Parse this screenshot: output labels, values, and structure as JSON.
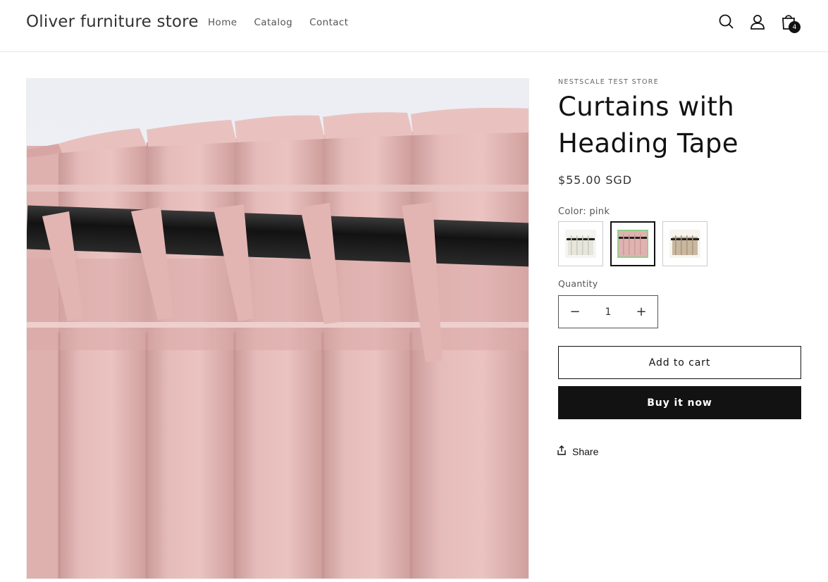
{
  "store": {
    "name": "Oliver furniture store"
  },
  "nav": {
    "items": [
      "Home",
      "Catalog",
      "Contact"
    ]
  },
  "header_icons": {
    "search": "search-icon",
    "account": "account-icon",
    "cart": "cart-icon"
  },
  "cart": {
    "count": "4"
  },
  "product": {
    "vendor": "NESTSCALE TEST STORE",
    "title": "Curtains with Heading Tape",
    "price": "$55.00 SGD",
    "color_label": "Color: pink",
    "colors": [
      {
        "name": "white",
        "hex": "#efefe8"
      },
      {
        "name": "pink",
        "hex": "#e2b5b3"
      },
      {
        "name": "beige",
        "hex": "#c9b79f"
      }
    ],
    "selected_color": "pink",
    "quantity_label": "Quantity",
    "quantity": "1",
    "decrease_symbol": "−",
    "increase_symbol": "+",
    "add_to_cart": "Add to cart",
    "buy_now": "Buy it now",
    "share": "Share"
  },
  "colors": {
    "accent": "#121212",
    "curtain_pink": "#e2b5b3",
    "rod": "#1e1e1e"
  }
}
